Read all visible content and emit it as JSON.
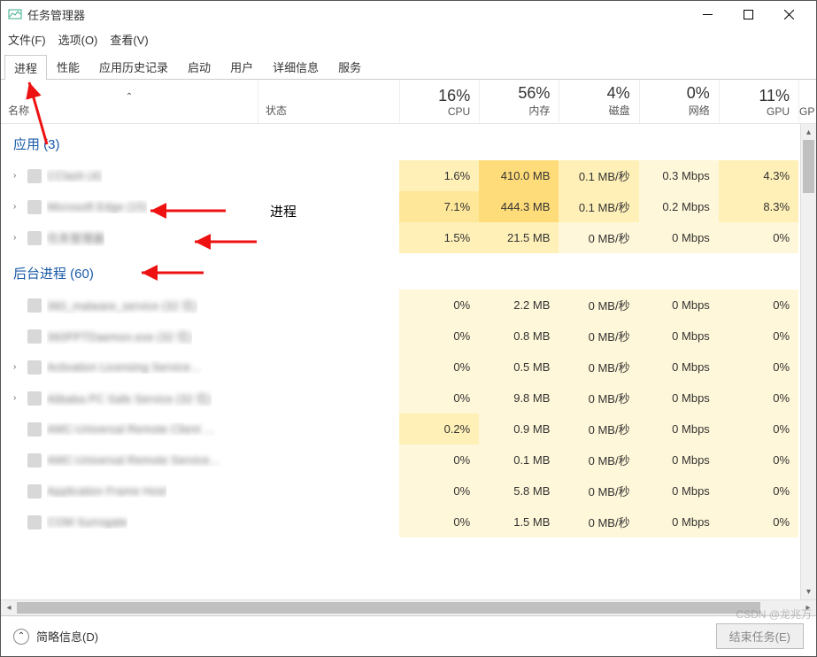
{
  "window": {
    "title": "任务管理器",
    "menus": [
      "文件(F)",
      "选项(O)",
      "查看(V)"
    ]
  },
  "tabs": [
    "进程",
    "性能",
    "应用历史记录",
    "启动",
    "用户",
    "详细信息",
    "服务"
  ],
  "active_tab": 0,
  "columns": {
    "name": "名称",
    "status": "状态",
    "metrics": [
      {
        "pct": "16%",
        "label": "CPU"
      },
      {
        "pct": "56%",
        "label": "内存"
      },
      {
        "pct": "4%",
        "label": "磁盘"
      },
      {
        "pct": "0%",
        "label": "网络"
      },
      {
        "pct": "11%",
        "label": "GPU"
      }
    ],
    "extra": "GP"
  },
  "groups": [
    {
      "title": "应用 (3)",
      "rows": [
        {
          "expandable": true,
          "name": "CClash (4)",
          "cpu": {
            "v": "1.6%",
            "h": 2
          },
          "mem": {
            "v": "410.0 MB",
            "h": 4
          },
          "disk": {
            "v": "0.1 MB/秒",
            "h": 2
          },
          "net": {
            "v": "0.3 Mbps",
            "h": 1
          },
          "gpu": {
            "v": "4.3%",
            "h": 2
          }
        },
        {
          "expandable": true,
          "name": "Microsoft Edge (15)",
          "cpu": {
            "v": "7.1%",
            "h": 3
          },
          "mem": {
            "v": "444.3 MB",
            "h": 4
          },
          "disk": {
            "v": "0.1 MB/秒",
            "h": 2
          },
          "net": {
            "v": "0.2 Mbps",
            "h": 1
          },
          "gpu": {
            "v": "8.3%",
            "h": 2
          }
        },
        {
          "expandable": true,
          "name": "任务管理器",
          "cpu": {
            "v": "1.5%",
            "h": 2
          },
          "mem": {
            "v": "21.5 MB",
            "h": 2
          },
          "disk": {
            "v": "0 MB/秒",
            "h": 1
          },
          "net": {
            "v": "0 Mbps",
            "h": 1
          },
          "gpu": {
            "v": "0%",
            "h": 1
          }
        }
      ]
    },
    {
      "title": "后台进程 (60)",
      "rows": [
        {
          "expandable": false,
          "name": "360_malware_service (32 位)",
          "cpu": {
            "v": "0%",
            "h": 1
          },
          "mem": {
            "v": "2.2 MB",
            "h": 1
          },
          "disk": {
            "v": "0 MB/秒",
            "h": 1
          },
          "net": {
            "v": "0 Mbps",
            "h": 1
          },
          "gpu": {
            "v": "0%",
            "h": 1
          }
        },
        {
          "expandable": false,
          "name": "360PPTDaemon.exe (32 位)",
          "cpu": {
            "v": "0%",
            "h": 1
          },
          "mem": {
            "v": "0.8 MB",
            "h": 1
          },
          "disk": {
            "v": "0 MB/秒",
            "h": 1
          },
          "net": {
            "v": "0 Mbps",
            "h": 1
          },
          "gpu": {
            "v": "0%",
            "h": 1
          }
        },
        {
          "expandable": true,
          "name": "Activation Licensing Service…",
          "cpu": {
            "v": "0%",
            "h": 1
          },
          "mem": {
            "v": "0.5 MB",
            "h": 1
          },
          "disk": {
            "v": "0 MB/秒",
            "h": 1
          },
          "net": {
            "v": "0 Mbps",
            "h": 1
          },
          "gpu": {
            "v": "0%",
            "h": 1
          }
        },
        {
          "expandable": true,
          "name": "Alibaba PC Safe Service (32 位)",
          "cpu": {
            "v": "0%",
            "h": 1
          },
          "mem": {
            "v": "9.8 MB",
            "h": 1
          },
          "disk": {
            "v": "0 MB/秒",
            "h": 1
          },
          "net": {
            "v": "0 Mbps",
            "h": 1
          },
          "gpu": {
            "v": "0%",
            "h": 1
          }
        },
        {
          "expandable": false,
          "name": "AMC-Universal Remote Client …",
          "cpu": {
            "v": "0.2%",
            "h": 2
          },
          "mem": {
            "v": "0.9 MB",
            "h": 1
          },
          "disk": {
            "v": "0 MB/秒",
            "h": 1
          },
          "net": {
            "v": "0 Mbps",
            "h": 1
          },
          "gpu": {
            "v": "0%",
            "h": 1
          }
        },
        {
          "expandable": false,
          "name": "AMC-Universal Remote Service…",
          "cpu": {
            "v": "0%",
            "h": 1
          },
          "mem": {
            "v": "0.1 MB",
            "h": 1
          },
          "disk": {
            "v": "0 MB/秒",
            "h": 1
          },
          "net": {
            "v": "0 Mbps",
            "h": 1
          },
          "gpu": {
            "v": "0%",
            "h": 1
          }
        },
        {
          "expandable": false,
          "name": "Application Frame Host",
          "cpu": {
            "v": "0%",
            "h": 1
          },
          "mem": {
            "v": "5.8 MB",
            "h": 1
          },
          "disk": {
            "v": "0 MB/秒",
            "h": 1
          },
          "net": {
            "v": "0 Mbps",
            "h": 1
          },
          "gpu": {
            "v": "0%",
            "h": 1
          }
        },
        {
          "expandable": false,
          "name": "COM Surrogate",
          "cpu": {
            "v": "0%",
            "h": 1
          },
          "mem": {
            "v": "1.5 MB",
            "h": 1
          },
          "disk": {
            "v": "0 MB/秒",
            "h": 1
          },
          "net": {
            "v": "0 Mbps",
            "h": 1
          },
          "gpu": {
            "v": "0%",
            "h": 1
          }
        }
      ]
    }
  ],
  "footer": {
    "fewer_details": "简略信息(D)",
    "end_task": "结束任务(E)"
  },
  "annotations": {
    "process_label": "进程"
  },
  "watermark": "CSDN @龙兆万"
}
